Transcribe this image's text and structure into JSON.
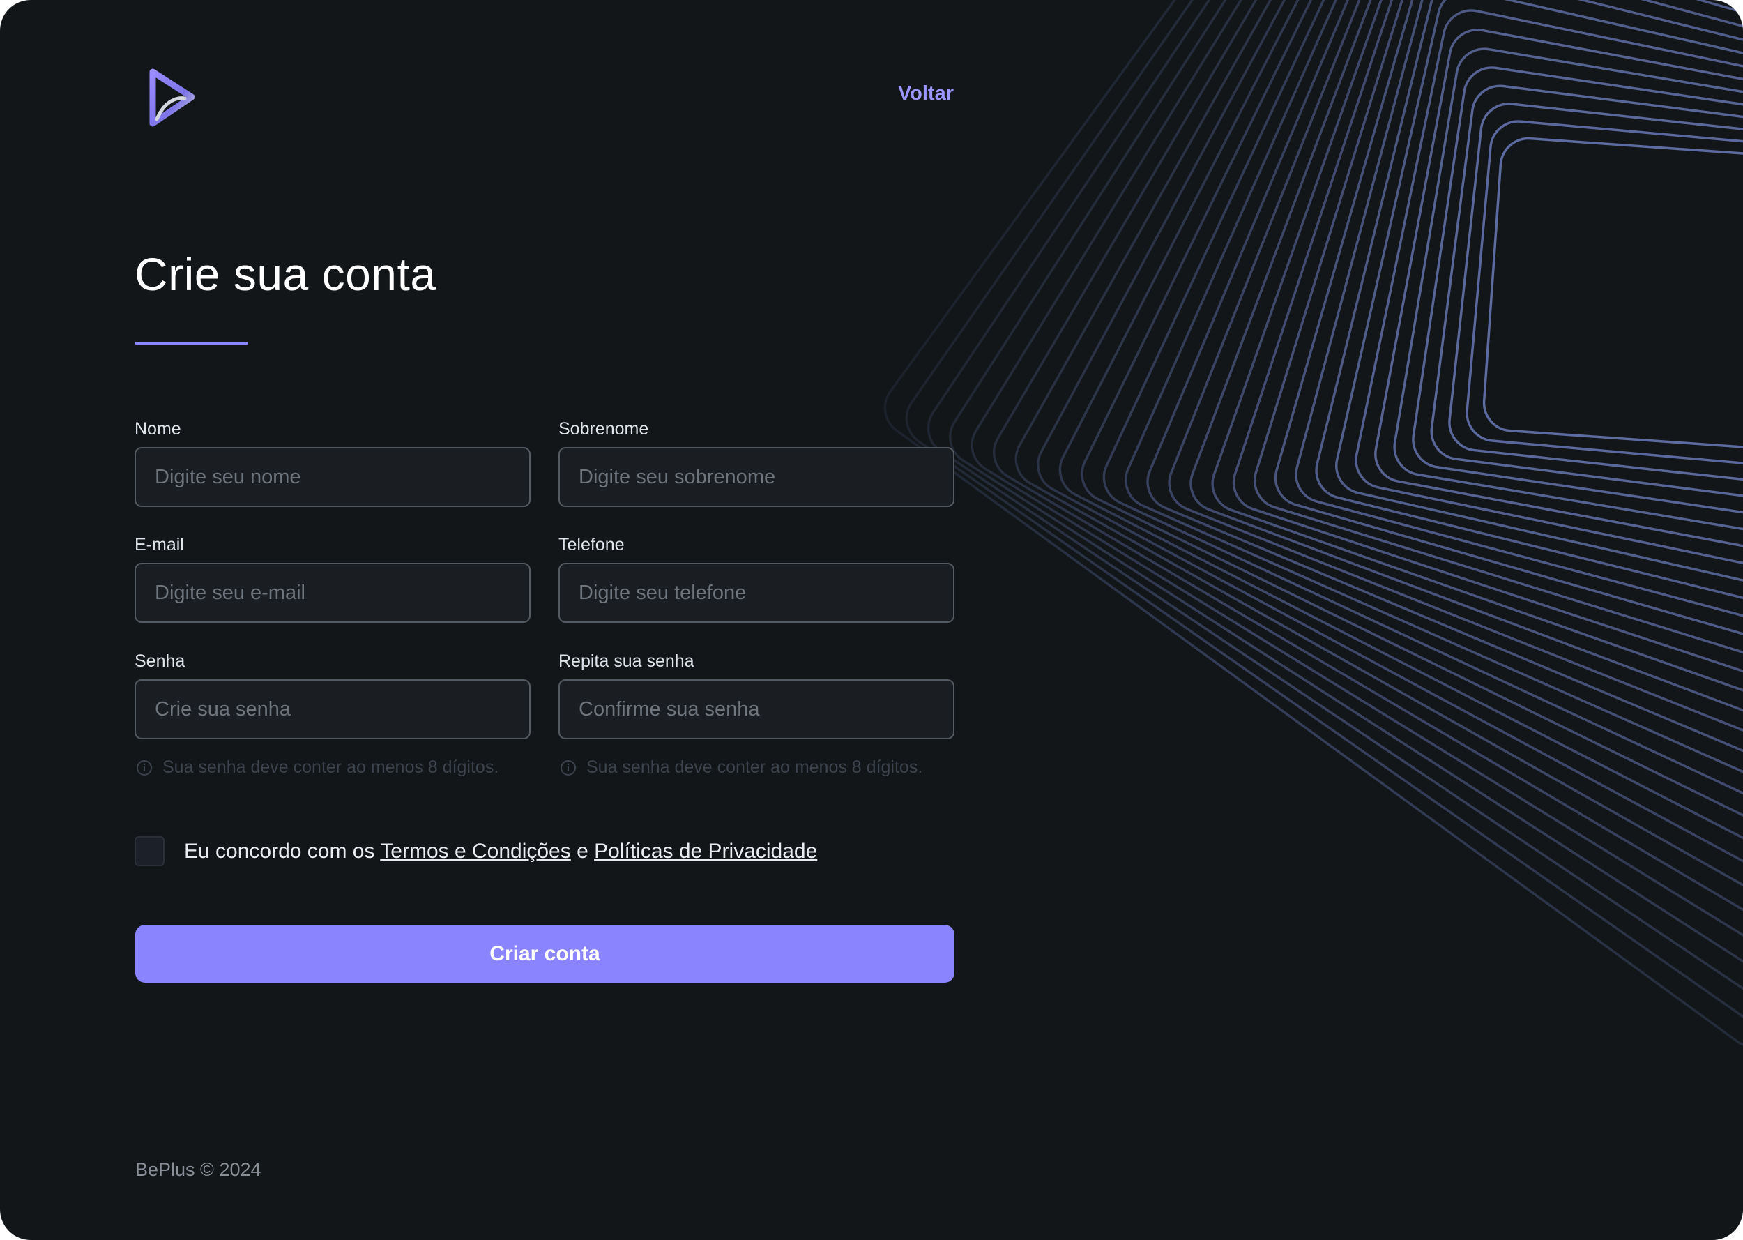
{
  "header": {
    "logo_icon": "play-triangle-logo-icon",
    "back_label": "Voltar"
  },
  "form": {
    "title": "Crie sua conta",
    "fields": {
      "first_name": {
        "label": "Nome",
        "placeholder": "Digite seu nome",
        "value": ""
      },
      "last_name": {
        "label": "Sobrenome",
        "placeholder": "Digite seu sobrenome",
        "value": ""
      },
      "email": {
        "label": "E-mail",
        "placeholder": "Digite seu e-mail",
        "value": ""
      },
      "phone": {
        "label": "Telefone",
        "placeholder": "Digite seu telefone",
        "value": ""
      },
      "password": {
        "label": "Senha",
        "placeholder": "Crie sua senha",
        "value": ""
      },
      "confirm_password": {
        "label": "Repita sua senha",
        "placeholder": "Confirme sua senha",
        "value": ""
      }
    },
    "password_hint": "Sua senha deve conter ao menos 8 dígitos.",
    "confirm_hint": "Sua senha deve conter ao menos 8 dígitos.",
    "agree": {
      "prefix": "Eu concordo com os",
      "terms_link": "Termos e Condições",
      "conjunction": "e",
      "privacy_link": "Políticas de Privacidade",
      "checked": false
    },
    "submit_label": "Criar conta"
  },
  "footer": {
    "copyright": "BePlus © 2024"
  },
  "colors": {
    "background": "#121619",
    "accent": "#8a85ff",
    "link": "#9b96ff",
    "input_background": "#1a1d21",
    "input_border": "#545a62",
    "decoration_line": "#6a7ab8"
  }
}
